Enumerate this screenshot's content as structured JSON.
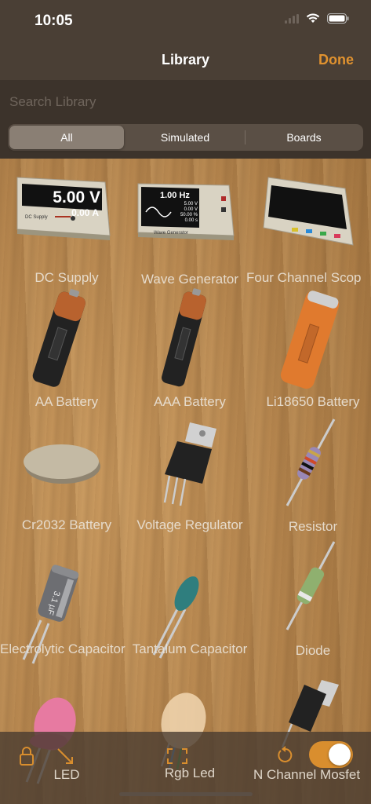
{
  "status": {
    "time": "10:05"
  },
  "nav": {
    "title": "Library",
    "done_label": "Done"
  },
  "search": {
    "placeholder": "Search Library"
  },
  "segments": [
    "All",
    "Simulated",
    "Boards"
  ],
  "devices": {
    "dc_supply": {
      "volts": "5.00 V",
      "amps": "0.00 A",
      "caption": "DC Supply"
    },
    "wave_gen": {
      "freq": "1.00 Hz",
      "r1": "5.00 V",
      "r2": "0.00 V",
      "r3": "50.00 %",
      "r4": "0.00 s",
      "caption": "Wave Generator"
    }
  },
  "items": [
    "DC Supply",
    "Wave Generator",
    "Four Channel Scop",
    "AA Battery",
    "AAA Battery",
    "Li18650 Battery",
    "Cr2032 Battery",
    "Voltage Regulator",
    "Resistor",
    "Electrolytic Capacitor",
    "Tantalum Capacitor",
    "Diode",
    "LED",
    "Rgb Led",
    "N Channel Mosfet"
  ],
  "capacitor_marking": "3.1 µF",
  "colors": {
    "accent": "#e0922f",
    "bar": "#4a3f35"
  }
}
